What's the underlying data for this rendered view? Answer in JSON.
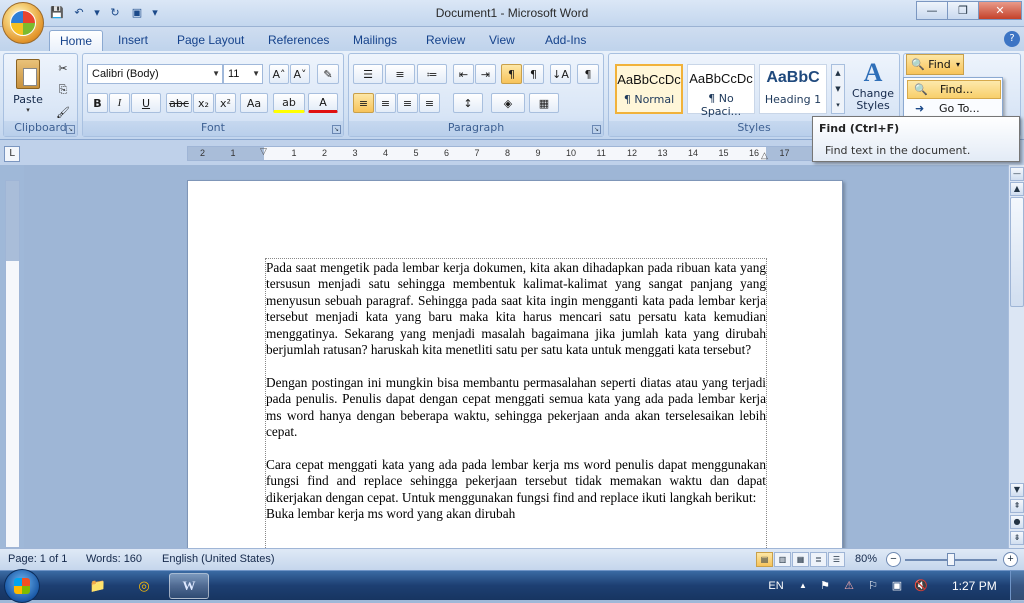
{
  "window": {
    "title": "Document1 - Microsoft Word",
    "minimize": "—",
    "maximize": "❐",
    "close": "✕"
  },
  "qat": {
    "save": "💾",
    "undo": "↶",
    "dropdown1": "▾",
    "redo": "↻",
    "picture": "▣",
    "customize": "▾"
  },
  "tabs": [
    {
      "label": "Home"
    },
    {
      "label": "Insert"
    },
    {
      "label": "Page Layout"
    },
    {
      "label": "References"
    },
    {
      "label": "Mailings"
    },
    {
      "label": "Review"
    },
    {
      "label": "View"
    },
    {
      "label": "Add-Ins"
    }
  ],
  "help": "?",
  "ribbon": {
    "clipboard": {
      "label": "Clipboard",
      "paste": "Paste",
      "cut": "✂",
      "copy": "⎘",
      "format_painter": "🖌"
    },
    "font": {
      "label": "Font",
      "font_name": "Calibri (Body)",
      "font_size": "11",
      "grow": "A˄",
      "shrink": "A˅",
      "clear": "✎",
      "bold": "B",
      "italic": "I",
      "underline": "U",
      "strike": "abc",
      "subscript": "x₂",
      "superscript": "x²",
      "change_case": "Aa",
      "highlight": "ab",
      "font_color": "A"
    },
    "paragraph": {
      "label": "Paragraph",
      "bullets": "☰",
      "numbering": "≡",
      "multilevel": "≔",
      "decrease_indent": "⇤",
      "increase_indent": "⇥",
      "ltr": "¶",
      "rtl": "¶",
      "sort": "↓A",
      "show_marks": "¶",
      "align_left": "≡",
      "align_center": "≡",
      "align_right": "≡",
      "justify": "≡",
      "line_spacing": "↕",
      "shading": "◈",
      "borders": "▦"
    },
    "styles": {
      "label": "Styles",
      "items": [
        {
          "sample": "AaBbCcDc",
          "name": "¶ Normal"
        },
        {
          "sample": "AaBbCcDc",
          "name": "¶ No Spaci..."
        },
        {
          "sample": "AaBbC",
          "name": "Heading 1"
        }
      ],
      "change_styles": "Change Styles",
      "change_styles_arrow": "▾"
    },
    "editing": {
      "find": "Find",
      "find_arrow": "▾"
    }
  },
  "find_menu": {
    "find": "Find...",
    "goto": "Go To..."
  },
  "tooltip": {
    "title": "Find (Ctrl+F)",
    "body": "Find text in the document."
  },
  "ruler": {
    "corner": "L",
    "ticks": [
      "2",
      "1",
      "1",
      "2",
      "3",
      "4",
      "5",
      "6",
      "7",
      "8",
      "9",
      "10",
      "11",
      "12",
      "13",
      "14",
      "15",
      "16",
      "17"
    ]
  },
  "document": {
    "paragraphs": [
      "Pada saat mengetik pada lembar kerja dokumen, kita akan dihadapkan pada ribuan kata yang tersusun menjadi satu sehingga membentuk kalimat-kalimat yang sangat panjang yang menyusun sebuah paragraf. Sehingga pada saat kita ingin mengganti kata pada lembar kerja tersebut menjadi kata yang baru maka kita harus mencari satu persatu kata kemudian menggatinya. Sekarang yang menjadi masalah bagaimana jika jumlah kata yang dirubah berjumlah ratusan? haruskah kita menetliti satu per satu kata untuk menggati kata tersebut?",
      "Dengan postingan ini mungkin bisa membantu permasalahan seperti diatas atau yang terjadi pada penulis. Penulis dapat dengan cepat menggati semua kata yang ada pada lembar kerja ms word hanya dengan beberapa waktu, sehingga pekerjaan anda akan terselesaikan lebih cepat.",
      "Cara cepat menggati kata yang ada pada lembar kerja ms word penulis dapat menggunakan fungsi find and replace sehingga pekerjaan tersebut tidak memakan waktu dan dapat dikerjakan dengan cepat. Untuk menggunakan fungsi find and replace ikuti langkah berikut:",
      "Buka lembar kerja ms word yang akan dirubah"
    ]
  },
  "scrollbar": {
    "up": "▲",
    "down": "▼",
    "prev_page": "⇞",
    "browse": "●",
    "next_page": "⇟",
    "split": "—"
  },
  "status": {
    "page": "Page: 1 of 1",
    "words": "Words: 160",
    "language": "English (United States)",
    "zoom": "80%",
    "zoom_out": "−",
    "zoom_in": "+",
    "zoom_level": 0.5
  },
  "taskbar": {
    "apps": [
      {
        "icon": "📁"
      },
      {
        "icon": "◎"
      },
      {
        "icon": "W"
      }
    ],
    "lang": "EN",
    "tray_arrow": "▲",
    "time": "1:27 PM"
  }
}
